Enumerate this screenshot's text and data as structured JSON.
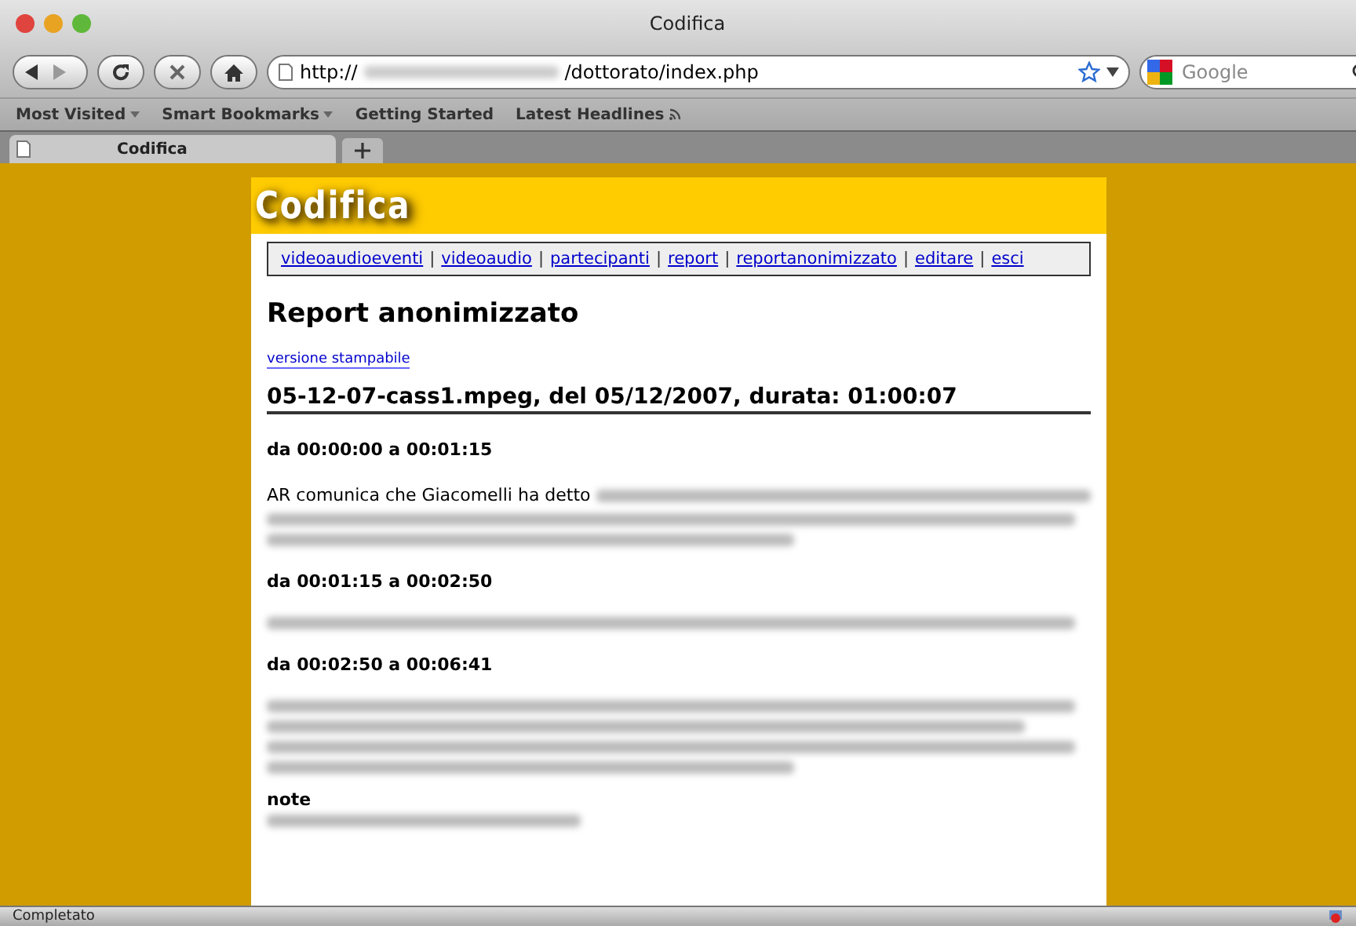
{
  "window": {
    "title": "Codifica"
  },
  "toolbar": {
    "url_prefix": "http://",
    "url_path": "/dottorato/index.php",
    "search": {
      "placeholder": "Google"
    }
  },
  "bookmarks": [
    {
      "label": "Most Visited",
      "kind": "menu"
    },
    {
      "label": "Smart Bookmarks",
      "kind": "menu"
    },
    {
      "label": "Getting Started",
      "kind": "link"
    },
    {
      "label": "Latest Headlines",
      "kind": "feed"
    }
  ],
  "tabs": [
    {
      "label": "Codifica",
      "selected": true
    }
  ],
  "page": {
    "logo": "Codifica",
    "nav_separator": "|",
    "nav": [
      "videoaudioeventi",
      "videoaudio",
      "partecipanti",
      "report",
      "reportanonimizzato",
      "editare",
      "esci"
    ],
    "heading": "Report anonimizzato",
    "print_link": "versione stampabile",
    "file_title": "05-12-07-cass1.mpeg, del 05/12/2007, durata: 01:00:07",
    "segments": [
      {
        "title": "da 00:00:00 a 00:01:15",
        "text": "AR comunica che Giacomelli ha detto"
      },
      {
        "title": "da 00:01:15 a 00:02:50"
      },
      {
        "title": "da 00:02:50 a 00:06:41"
      }
    ],
    "note_title": "note"
  },
  "status_bar": {
    "text": "Completato"
  }
}
